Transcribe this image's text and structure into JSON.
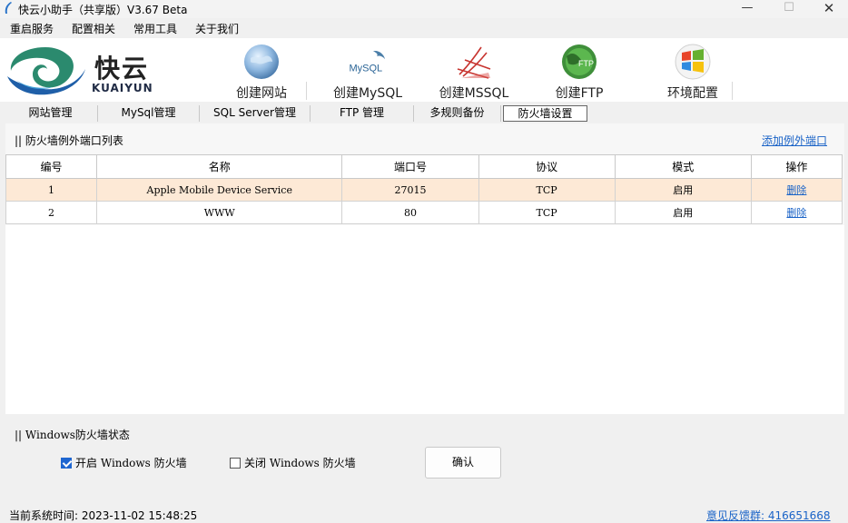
{
  "window": {
    "title": "快云小助手（共享版）V3.67 Beta"
  },
  "menu": [
    "重启服务",
    "配置相关",
    "常用工具",
    "关于我们"
  ],
  "logo": {
    "cn": "快云",
    "en": "KUAIYUN"
  },
  "toolbar": [
    {
      "label": "创建网站",
      "icon": "globe-icon"
    },
    {
      "label": "创建MySQL",
      "icon": "mysql-icon",
      "icon_text": "MySQL"
    },
    {
      "label": "创建MSSQL",
      "icon": "mssql-icon"
    },
    {
      "label": "创建FTP",
      "icon": "ftp-icon",
      "icon_text": "FTP"
    },
    {
      "label": "环境配置",
      "icon": "windows-icon"
    }
  ],
  "tabs": [
    "网站管理",
    "MySql管理",
    "SQL Server管理",
    "FTP 管理",
    "多规则备份",
    "防火墙设置"
  ],
  "active_tab": "防火墙设置",
  "firewall_list": {
    "title": "|| 防火墙例外端口列表",
    "add_link": "添加例外端口",
    "columns": [
      "编号",
      "名称",
      "端口号",
      "协议",
      "模式",
      "操作"
    ],
    "rows": [
      {
        "id": "1",
        "name": "Apple Mobile Device Service",
        "port": "27015",
        "protocol": "TCP",
        "mode": "启用",
        "action": "删除"
      },
      {
        "id": "2",
        "name": "WWW",
        "port": "80",
        "protocol": "TCP",
        "mode": "启用",
        "action": "删除"
      }
    ]
  },
  "firewall_status": {
    "title": "|| Windows防火墙状态",
    "enable_label": "开启 Windows 防火墙",
    "enable_checked": true,
    "disable_label": "关闭 Windows 防火墙",
    "disable_checked": false,
    "confirm": "确认"
  },
  "status": {
    "time": "当前系统时间: 2023-11-02 15:48:25",
    "feedback": "意见反馈群: 416651668"
  },
  "colors": {
    "link": "#1a63c7",
    "selected_row": "#fde9d6",
    "check_accent": "#1e66d0"
  }
}
